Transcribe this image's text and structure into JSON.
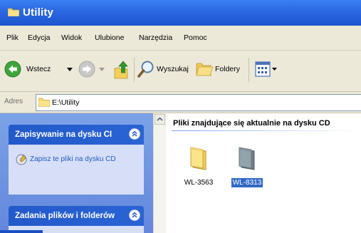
{
  "window": {
    "title": "Utility"
  },
  "menu": [
    "Plik",
    "Edycja",
    "Widok",
    "Ulubione",
    "Narzędzia",
    "Pomoc"
  ],
  "toolbar": {
    "back_label": "Wstecz",
    "search_label": "Wyszukaj",
    "folders_label": "Foldery"
  },
  "address": {
    "label": "Adres",
    "path": "E:\\Utility"
  },
  "tasks": {
    "cd_title": "Zapisywanie na dysku CI",
    "cd_link": "Zapisz te pliki na dysku CD",
    "files_title": "Zadania plików i folderów"
  },
  "content": {
    "group_title": "Pliki znajdujące się aktualnie na dysku CD",
    "items": [
      {
        "label": "WL-3563",
        "selected": false
      },
      {
        "label": "WL-8313",
        "selected": true
      }
    ]
  },
  "colors": {
    "title_bar": "#2a67e0",
    "task_pane": "#6f96e0",
    "selection": "#316ac5"
  }
}
